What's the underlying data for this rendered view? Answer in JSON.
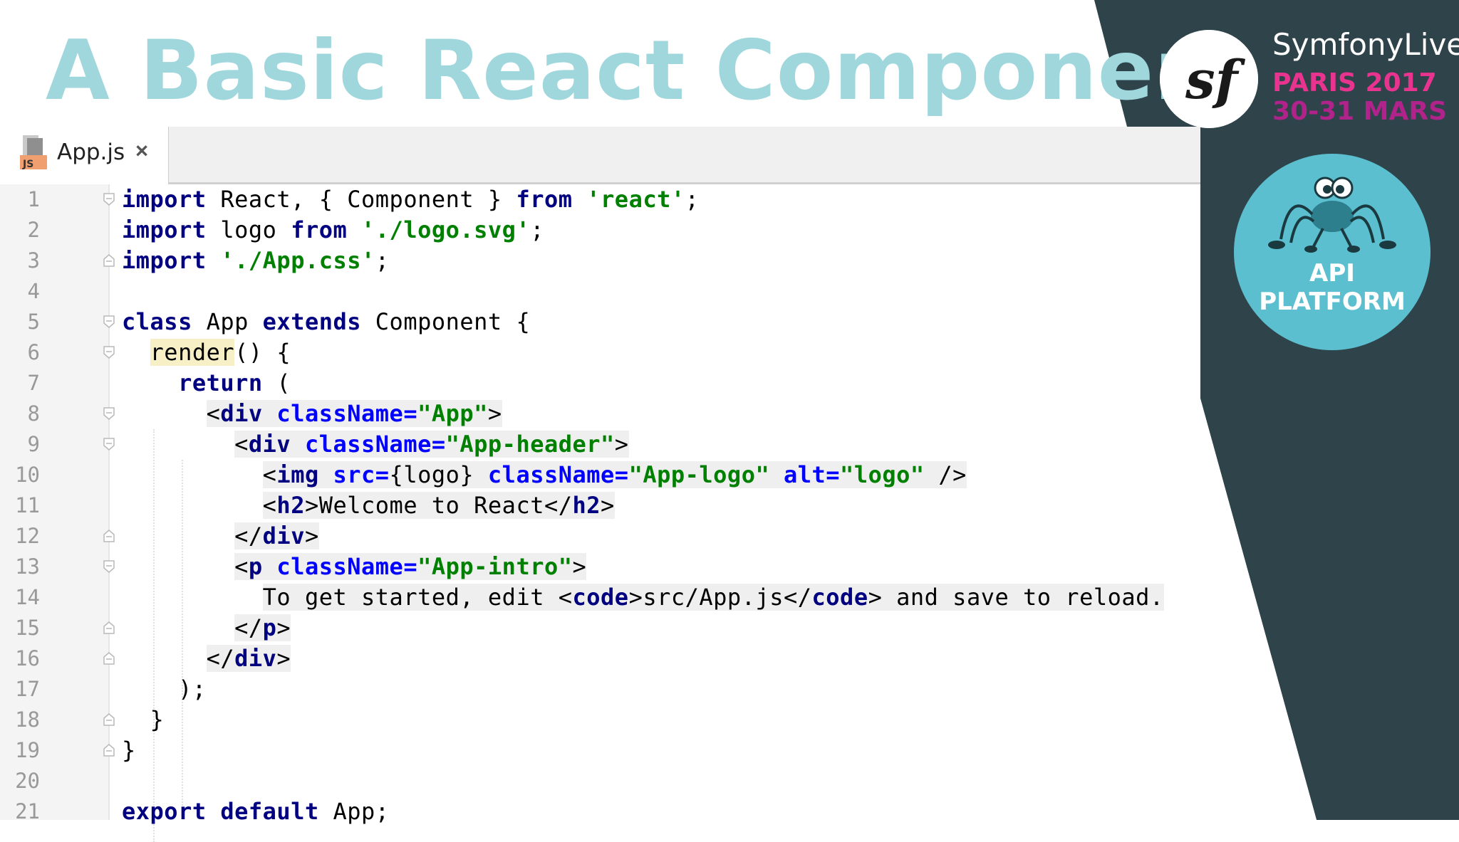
{
  "slide": {
    "title": "A Basic React Component"
  },
  "branding": {
    "symfony_live": "SymfonyLive",
    "event_city_year": "PARIS 2017",
    "event_dates": "30-31 MARS",
    "api_platform_line1": "API",
    "api_platform_line2": "PLATFORM",
    "colors": {
      "title": "#9fd7dd",
      "sidebar_dark": "#2e434a",
      "accent_pink": "#e8338f",
      "api_badge": "#5bbfcf"
    }
  },
  "editor": {
    "tab": {
      "file_icon": "js-file-icon",
      "file_icon_label": "JS",
      "label": "App.js",
      "close": "×"
    },
    "lines": [
      {
        "n": "1"
      },
      {
        "n": "2"
      },
      {
        "n": "3"
      },
      {
        "n": "4"
      },
      {
        "n": "5"
      },
      {
        "n": "6"
      },
      {
        "n": "7"
      },
      {
        "n": "8"
      },
      {
        "n": "9"
      },
      {
        "n": "10"
      },
      {
        "n": "11"
      },
      {
        "n": "12"
      },
      {
        "n": "13"
      },
      {
        "n": "14"
      },
      {
        "n": "15"
      },
      {
        "n": "16"
      },
      {
        "n": "17"
      },
      {
        "n": "18"
      },
      {
        "n": "19"
      },
      {
        "n": "20"
      },
      {
        "n": "21"
      }
    ],
    "code": {
      "l1": {
        "a": "import",
        "b": " React, { Component } ",
        "c": "from",
        "d": " ",
        "e": "'react'",
        "f": ";"
      },
      "l2": {
        "a": "import",
        "b": " logo ",
        "c": "from",
        "d": " ",
        "e": "'./logo.svg'",
        "f": ";"
      },
      "l3": {
        "a": "import",
        "b": " ",
        "e": "'./App.css'",
        "f": ";"
      },
      "l5": {
        "a": "class",
        "b": " App ",
        "c": "extends",
        "d": " Component {"
      },
      "l6": {
        "a": "render",
        "b": "() {"
      },
      "l7": {
        "a": "return",
        "b": " ("
      },
      "l8": {
        "a": "<",
        "b": "div",
        "c": " ",
        "d": "className=",
        "e": "\"App\"",
        "f": ">"
      },
      "l9": {
        "a": "<",
        "b": "div",
        "c": " ",
        "d": "className=",
        "e": "\"App-header\"",
        "f": ">"
      },
      "l10": {
        "a": "<",
        "b": "img",
        "c": " ",
        "d": "src=",
        "e": "{logo}",
        "f": " ",
        "g": "className=",
        "h": "\"App-logo\"",
        "i": " ",
        "j": "alt=",
        "k": "\"logo\"",
        "l": " />"
      },
      "l11": {
        "a": "<",
        "b": "h2",
        "c": ">",
        "d": "Welcome to React",
        "e": "</",
        "f": "h2",
        "g": ">"
      },
      "l12": {
        "a": "</",
        "b": "div",
        "c": ">"
      },
      "l13": {
        "a": "<",
        "b": "p",
        "c": " ",
        "d": "className=",
        "e": "\"App-intro\"",
        "f": ">"
      },
      "l14": {
        "a": "To get started, edit ",
        "b": "<",
        "c": "code",
        "d": ">",
        "e": "src/App.js",
        "f": "</",
        "g": "code",
        "h": ">",
        "i": " and save to reload."
      },
      "l15": {
        "a": "</",
        "b": "p",
        "c": ">"
      },
      "l16": {
        "a": "</",
        "b": "div",
        "c": ">"
      },
      "l17": {
        "a": ");"
      },
      "l18": {
        "a": "}"
      },
      "l19": {
        "a": "}"
      },
      "l21": {
        "a": "export",
        "b": " ",
        "c": "default",
        "d": " App;"
      }
    }
  }
}
